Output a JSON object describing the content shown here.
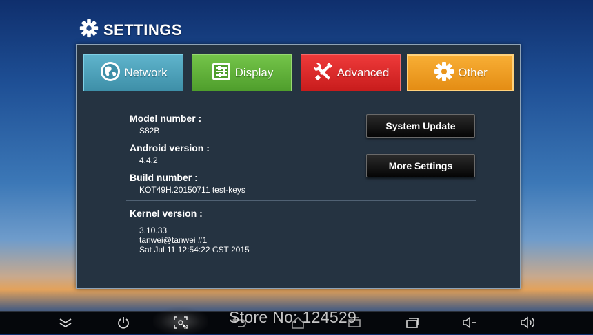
{
  "header": {
    "title": "SETTINGS",
    "icon": "gear-icon"
  },
  "tabs": [
    {
      "label": "Network",
      "icon": "globe-icon",
      "color": "#4aa1bb"
    },
    {
      "label": "Display",
      "icon": "display-sliders-icon",
      "color": "#5fb03a"
    },
    {
      "label": "Advanced",
      "icon": "tools-icon",
      "color": "#dc2a2a"
    },
    {
      "label": "Other",
      "icon": "gear-icon",
      "color": "#f0a024",
      "selected": true
    }
  ],
  "info": {
    "model_label": "Model number :",
    "model_value": "S82B",
    "android_label": "Android version :",
    "android_value": "4.4.2",
    "build_label": "Build number :",
    "build_value": "KOT49H.20150711 test-keys",
    "kernel_label": "Kernel version :",
    "kernel_lines": [
      "3.10.33",
      "tanwei@tanwei #1",
      "Sat Jul 11 12:54:22 CST 2015"
    ]
  },
  "buttons": {
    "system_update": "System Update",
    "more_settings": "More Settings"
  },
  "navbar": {
    "icons": [
      "hide-icon",
      "power-icon",
      "screenshot-icon",
      "back-icon",
      "home-icon",
      "recent-apps-icon",
      "volume-down-icon",
      "volume-up-icon"
    ],
    "focused": "screenshot-icon"
  },
  "watermark": "Store No: 124529"
}
